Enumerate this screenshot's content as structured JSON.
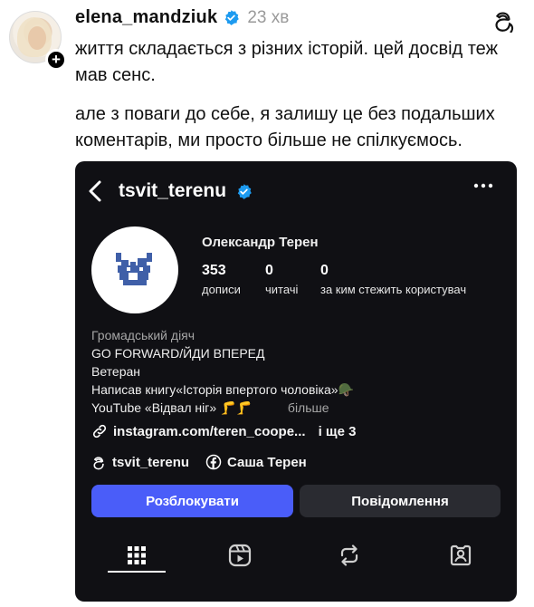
{
  "post": {
    "username": "elena_mandziuk",
    "time": "23 хв",
    "paragraph1": "життя складається з різних історій. цей досвід теж мав сенс.",
    "paragraph2": "але з поваги до себе, я залишу це без подальших коментарів, ми просто більше не спілкуємось."
  },
  "card": {
    "username": "tsvit_terenu",
    "full_name": "Олександр Терен",
    "stats": [
      {
        "num": "353",
        "label": "дописи"
      },
      {
        "num": "0",
        "label": "читачі"
      },
      {
        "num": "0",
        "label": "за ким стежить користувач"
      }
    ],
    "bio": {
      "category": "Громадський діяч",
      "line1": "GO FORWARD/ЙДИ ВПЕРЕД",
      "line2": "Ветеран",
      "line3": "Написав книгу«Історія впертого чоловіка»🪖",
      "line4": "YouTube «Відвал ніг» 🦵🦵",
      "more": "більше"
    },
    "link": {
      "text": "instagram.com/teren_coope...",
      "extra": "і ще 3"
    },
    "threads_handle": "tsvit_terenu",
    "facebook_name": "Саша Терен",
    "buttons": {
      "unblock": "Розблокувати",
      "message": "Повідомлення"
    },
    "tabs": [
      {
        "icon": "grid-icon"
      },
      {
        "icon": "reels-icon"
      },
      {
        "icon": "repost-icon"
      },
      {
        "icon": "tagged-icon"
      }
    ]
  },
  "colors": {
    "card_bg": "#101014",
    "primary_button": "#4a5df9",
    "secondary_button": "#2a2b31",
    "verified_blue": "#1d9bf0"
  }
}
